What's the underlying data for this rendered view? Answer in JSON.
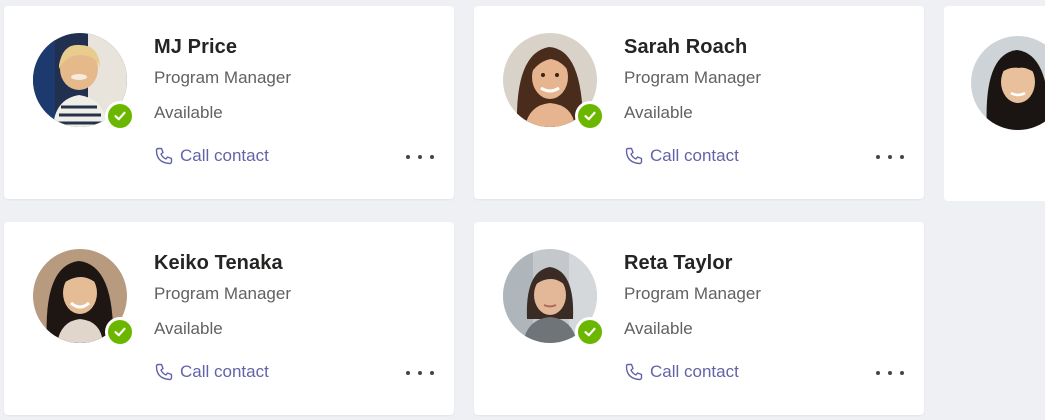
{
  "contacts": [
    {
      "name": "MJ Price",
      "role": "Program Manager",
      "status": "Available",
      "call_label": "Call contact",
      "avatar": "photo-avatar-blonde-woman"
    },
    {
      "name": "Sarah Roach",
      "role": "Program Manager",
      "status": "Available",
      "call_label": "Call contact",
      "avatar": "photo-avatar-brunette-woman"
    },
    {
      "name": "Keiko Tenaka",
      "role": "Program Manager",
      "status": "Available",
      "call_label": "Call contact",
      "avatar": "photo-avatar-dark-hair-woman"
    },
    {
      "name": "Reta Taylor",
      "role": "Program Manager",
      "status": "Available",
      "call_label": "Call contact",
      "avatar": "photo-avatar-woman-office"
    }
  ],
  "icons": {
    "call": "phone-icon",
    "more": "more-options-icon",
    "presence": "available-check-icon"
  },
  "colors": {
    "accent": "#6264a7",
    "available": "#6bb700",
    "background": "#eef0f4",
    "card": "#ffffff"
  }
}
